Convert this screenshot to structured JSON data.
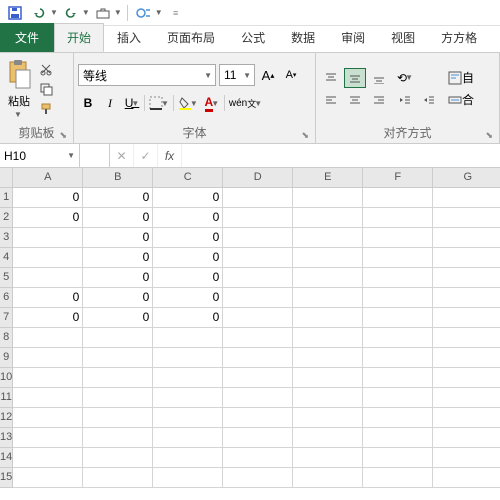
{
  "qat": {
    "save": "save",
    "undo": "undo",
    "redo": "redo"
  },
  "tabs": {
    "file": "文件",
    "home": "开始",
    "insert": "插入",
    "layout": "页面布局",
    "formulas": "公式",
    "data": "数据",
    "review": "审阅",
    "view": "视图",
    "extra": "方方格"
  },
  "ribbon": {
    "clipboard": {
      "label": "剪贴板",
      "paste": "粘贴"
    },
    "font": {
      "label": "字体",
      "name": "等线",
      "size": "11",
      "bold": "B",
      "italic": "I",
      "underline": "U",
      "wen": "wén"
    },
    "align": {
      "label": "对齐方式",
      "merge": "合"
    }
  },
  "namebox": "H10",
  "fx": "fx",
  "columns": [
    "A",
    "B",
    "C",
    "D",
    "E",
    "F",
    "G"
  ],
  "rows": [
    "1",
    "2",
    "3",
    "4",
    "5",
    "6",
    "7",
    "8",
    "9",
    "10",
    "11",
    "12",
    "13",
    "14",
    "15"
  ],
  "cells": {
    "A1": "0",
    "B1": "0",
    "C1": "0",
    "A2": "0",
    "B2": "0",
    "C2": "0",
    "B3": "0",
    "C3": "0",
    "B4": "0",
    "C4": "0",
    "B5": "0",
    "C5": "0",
    "A6": "0",
    "B6": "0",
    "C6": "0",
    "A7": "0",
    "B7": "0",
    "C7": "0"
  }
}
